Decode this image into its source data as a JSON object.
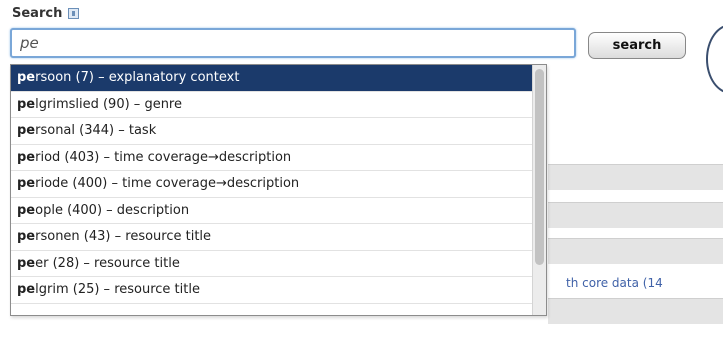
{
  "search": {
    "label": "Search",
    "value": "pe",
    "button_label": "search"
  },
  "suggestions": [
    {
      "prefix": "pe",
      "rest": "rsoon (7) – explanatory context",
      "active": true
    },
    {
      "prefix": "pe",
      "rest": "lgrimslied (90) – genre",
      "active": false
    },
    {
      "prefix": "pe",
      "rest": "rsonal (344) – task",
      "active": false
    },
    {
      "prefix": "pe",
      "rest": "riod (403) – time coverage→description",
      "active": false
    },
    {
      "prefix": "pe",
      "rest": "riode (400) – time coverage→description",
      "active": false
    },
    {
      "prefix": "pe",
      "rest": "ople (400) – description",
      "active": false
    },
    {
      "prefix": "pe",
      "rest": "rsonen (43) – resource title",
      "active": false
    },
    {
      "prefix": "pe",
      "rest": "er (28) – resource title",
      "active": false
    },
    {
      "prefix": "pe",
      "rest": "lgrim (25) – resource title",
      "active": false
    }
  ],
  "background": {
    "link_text": "th core data (14"
  },
  "colors": {
    "highlight": "#1b3a6b",
    "input_border": "#7aa7d8",
    "link": "#4062a8"
  },
  "icons": {
    "info": "info-icon"
  }
}
